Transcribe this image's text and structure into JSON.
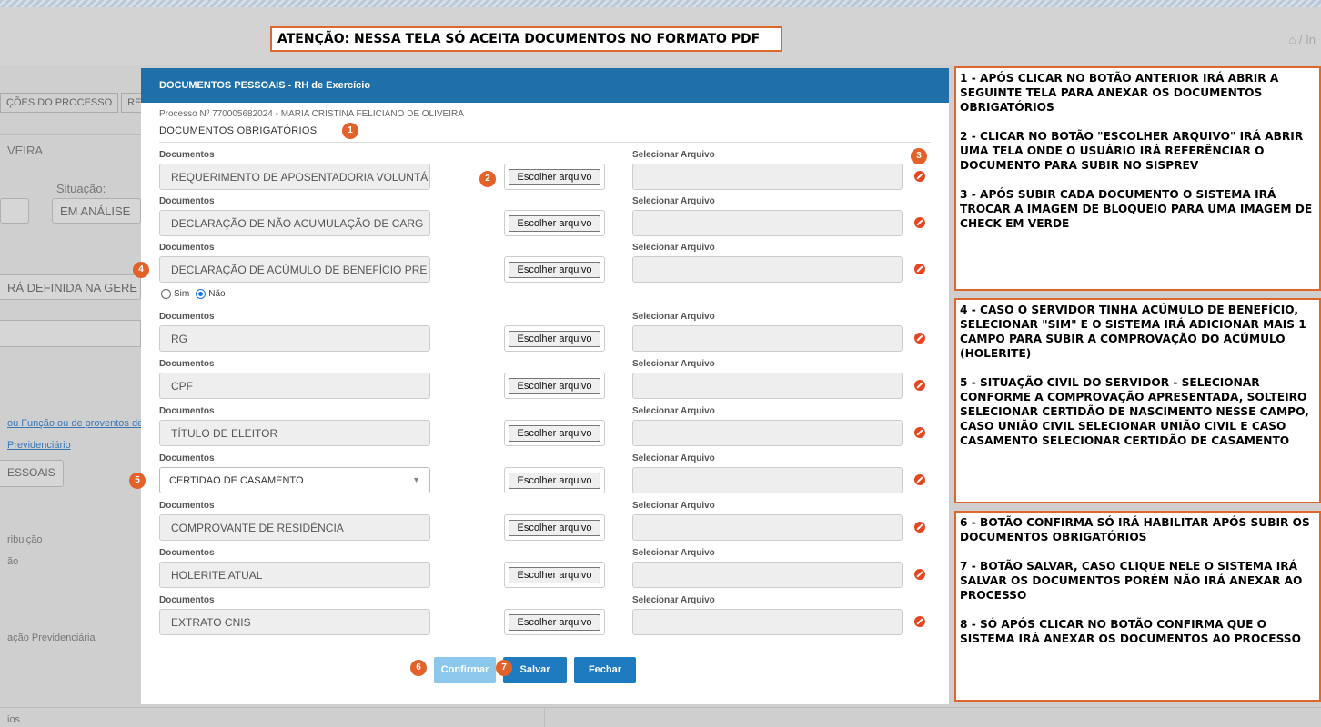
{
  "background": {
    "breadcrumb": "/ In",
    "tabs": [
      "ÇÕES DO PROCESSO",
      "RE"
    ],
    "name_value": "VEIRA",
    "situacao_label": "Situação:",
    "situacao_value": "EM ANÁLISE",
    "gere_value": "RÁ DEFINIDA NA GERE",
    "link1": "ou Função ou de proventos de",
    "link2": "Previdenciário",
    "pessoais_button": "ESSOAIS",
    "text1": "ribuição",
    "text2": "ão",
    "text3": "ação Previdenciária",
    "text4": "ios"
  },
  "notice": "ATENÇÃO: NESSA TELA SÓ ACEITA DOCUMENTOS NO FORMATO PDF",
  "modal": {
    "title": "DOCUMENTOS PESSOAIS - RH de Exercício",
    "processo": "Processo Nº 770005682024 - MARIA CRISTINA FELICIANO DE OLIVEIRA",
    "section_title": "DOCUMENTOS OBRIGATÓRIOS",
    "col_documentos": "Documentos",
    "col_selecionar": "Selecionar Arquivo",
    "file_button": "Escolher arquivo",
    "rows": [
      {
        "value": "REQUERIMENTO DE APOSENTADORIA VOLUNTÁ"
      },
      {
        "value": "DECLARAÇÃO DE NÃO ACUMULAÇÃO DE CARG"
      },
      {
        "value": "DECLARAÇÃO DE ACÚMULO DE BENEFÍCIO PRE"
      },
      {
        "value": "RG"
      },
      {
        "value": "CPF"
      },
      {
        "value": "TÍTULO DE ELEITOR"
      },
      {
        "value": "CERTIDAO DE CASAMENTO"
      },
      {
        "value": "COMPROVANTE DE RESIDÊNCIA"
      },
      {
        "value": "HOLERITE ATUAL"
      },
      {
        "value": "EXTRATO CNIS"
      }
    ],
    "radio_sim": "Sim",
    "radio_nao": "Não",
    "radio_selected": "Não",
    "buttons": {
      "confirm": "Confirmar",
      "save": "Salvar",
      "close": "Fechar"
    }
  },
  "badges": [
    "1",
    "2",
    "3",
    "4",
    "5",
    "6",
    "7"
  ],
  "notes": [
    [
      "1 - APÓS CLICAR NO BOTÃO ANTERIOR IRÁ ABRIR A SEGUINTE TELA PARA ANEXAR OS DOCUMENTOS OBRIGATÓRIOS",
      "2 - CLICAR NO BOTÃO \"ESCOLHER ARQUIVO\" IRÁ ABRIR UMA TELA ONDE O USUÁRIO IRÁ REFERÊNCIAR O DOCUMENTO PARA SUBIR NO SISPREV",
      "3 - APÓS SUBIR CADA DOCUMENTO O SISTEMA IRÁ TROCAR A IMAGEM DE BLOQUEIO PARA UMA IMAGEM DE CHECK EM VERDE"
    ],
    [
      "4 - CASO O SERVIDOR TINHA ACÚMULO DE BENEFÍCIO, SELECIONAR \"SIM\" E O SISTEMA IRÁ ADICIONAR MAIS 1 CAMPO PARA SUBIR A COMPROVAÇÃO DO ACÚMULO (HOLERITE)",
      "5 - SITUAÇÃO CIVIL DO SERVIDOR - SELECIONAR CONFORME A COMPROVAÇÃO APRESENTADA, SOLTEIRO SELECIONAR CERTIDÃO DE NASCIMENTO NESSE CAMPO, CASO UNIÃO CIVIL SELECIONAR UNIÃO CIVIL E CASO CASAMENTO SELECIONAR CERTIDÃO DE CASAMENTO"
    ],
    [
      "6 - BOTÃO CONFIRMA SÓ IRÁ HABILITAR APÓS SUBIR OS DOCUMENTOS OBRIGATÓRIOS",
      "7 - BOTÃO SALVAR, CASO CLIQUE NELE O SISTEMA IRÁ SALVAR OS DOCUMENTOS PORÉM NÃO IRÁ ANEXAR AO PROCESSO",
      "8 - SÓ APÓS CLICAR NO BOTÃO CONFIRMA QUE O SISTEMA IRÁ ANEXAR OS DOCUMENTOS AO PROCESSO"
    ]
  ]
}
